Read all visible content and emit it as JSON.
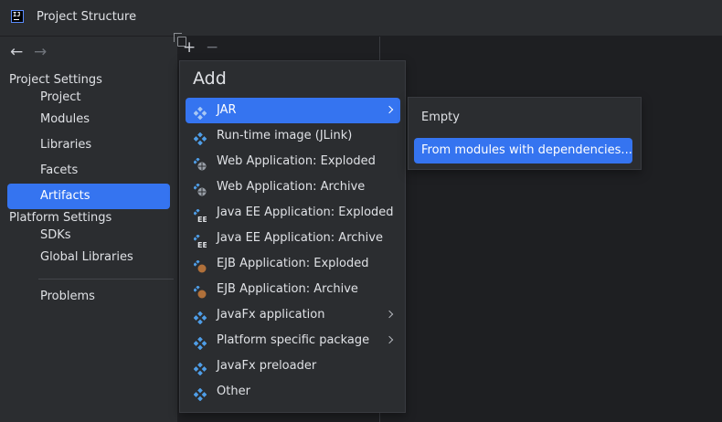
{
  "window": {
    "title": "Project Structure",
    "logo_text": "IJ"
  },
  "nav": {
    "back": "←",
    "forward": "→"
  },
  "sidebar": {
    "project_settings_label": "Project Settings",
    "project_items": [
      "Project",
      "Modules",
      "Libraries",
      "Facets",
      "Artifacts"
    ],
    "platform_settings_label": "Platform Settings",
    "platform_items": [
      "SDKs",
      "Global Libraries"
    ],
    "problems": "Problems",
    "selected": "Artifacts"
  },
  "toolbar": {
    "add": "+",
    "remove": "−"
  },
  "add_popup": {
    "title": "Add",
    "items": [
      {
        "label": "JAR",
        "icon": "jar-artifact-icon",
        "submenu": true,
        "selected": true
      },
      {
        "label": "Run-time image (JLink)",
        "icon": "jar-artifact-icon"
      },
      {
        "label": "Web Application: Exploded",
        "icon": "web-app-icon"
      },
      {
        "label": "Web Application: Archive",
        "icon": "web-app-icon"
      },
      {
        "label": "Java EE Application: Exploded",
        "icon": "java-ee-icon"
      },
      {
        "label": "Java EE Application: Archive",
        "icon": "java-ee-icon"
      },
      {
        "label": "EJB Application: Exploded",
        "icon": "ejb-icon"
      },
      {
        "label": "EJB Application: Archive",
        "icon": "ejb-icon"
      },
      {
        "label": "JavaFx application",
        "icon": "jar-artifact-icon",
        "submenu": true
      },
      {
        "label": "Platform specific package",
        "icon": "jar-artifact-icon",
        "submenu": true
      },
      {
        "label": "JavaFx preloader",
        "icon": "jar-artifact-icon"
      },
      {
        "label": "Other",
        "icon": "jar-artifact-icon"
      }
    ]
  },
  "jar_submenu": {
    "items": [
      {
        "label": "Empty"
      },
      {
        "label": "From modules with dependencies...",
        "selected": true
      }
    ]
  },
  "colors": {
    "window_bg": "#2b2d30",
    "pane_bg": "#1e1f22",
    "selection": "#3574f0",
    "text": "#dfe1e5",
    "artifact_icon": "#4f9ee8"
  }
}
